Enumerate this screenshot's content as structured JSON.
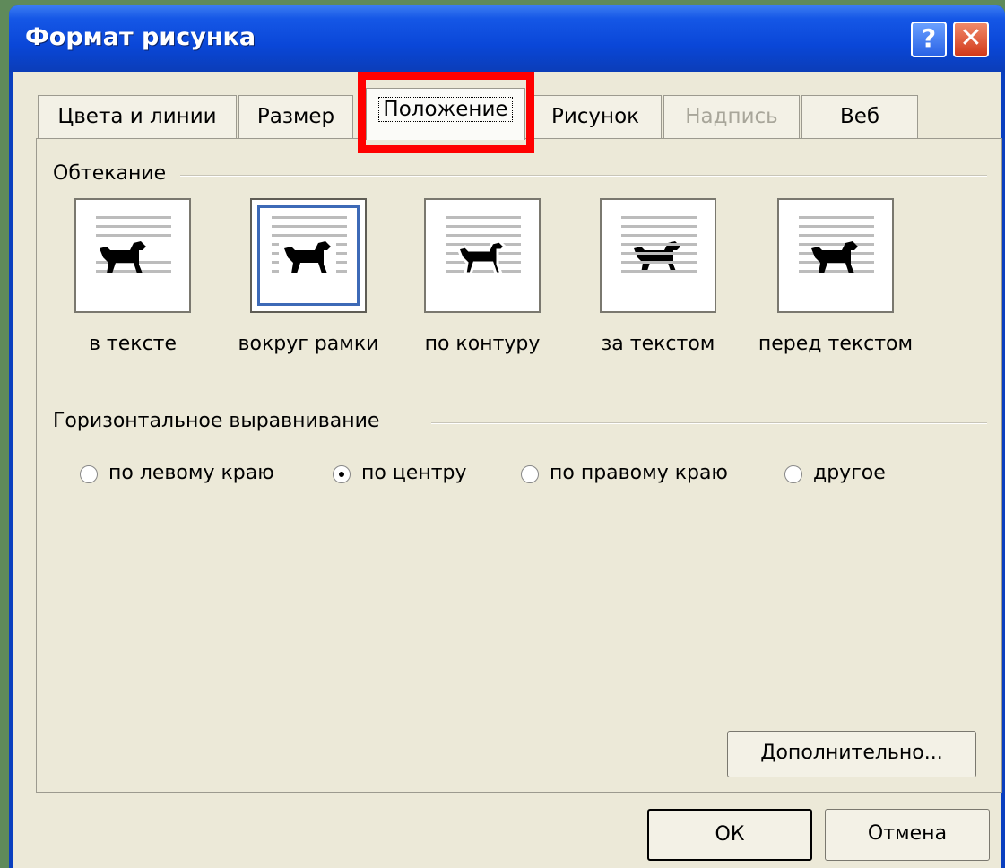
{
  "window": {
    "title": "Формат рисунка",
    "help_glyph": "?",
    "close_glyph": "✕"
  },
  "tabs": [
    {
      "label": "Цвета и линии",
      "state": "normal"
    },
    {
      "label": "Размер",
      "state": "normal"
    },
    {
      "label": "Положение",
      "state": "active"
    },
    {
      "label": "Рисунок",
      "state": "normal"
    },
    {
      "label": "Надпись",
      "state": "disabled"
    },
    {
      "label": "Веб",
      "state": "normal"
    }
  ],
  "wrapping": {
    "group_label": "Обтекание",
    "options": [
      {
        "label": "в тексте",
        "icon": "inline-text-dog-icon",
        "selected": false
      },
      {
        "label": "вокруг рамки",
        "icon": "square-wrap-dog-icon",
        "selected": true
      },
      {
        "label": "по контуру",
        "icon": "tight-wrap-dog-icon",
        "selected": false
      },
      {
        "label": "за текстом",
        "icon": "behind-text-dog-icon",
        "selected": false
      },
      {
        "label": "перед текстом",
        "icon": "front-text-dog-icon",
        "selected": false
      }
    ]
  },
  "horizontal_alignment": {
    "group_label": "Горизонтальное выравнивание",
    "options": [
      {
        "label": "по левому краю",
        "checked": false
      },
      {
        "label": "по центру",
        "checked": true
      },
      {
        "label": "по правому краю",
        "checked": false
      },
      {
        "label": "другое",
        "checked": false
      }
    ]
  },
  "buttons": {
    "advanced": "Дополнительно...",
    "ok": "ОК",
    "cancel": "Отмена"
  },
  "colors": {
    "highlight": "#ff0000",
    "titlebar": "#0a47d8",
    "dialog_bg": "#ece9d8",
    "selection_border": "#3d6ab7"
  }
}
